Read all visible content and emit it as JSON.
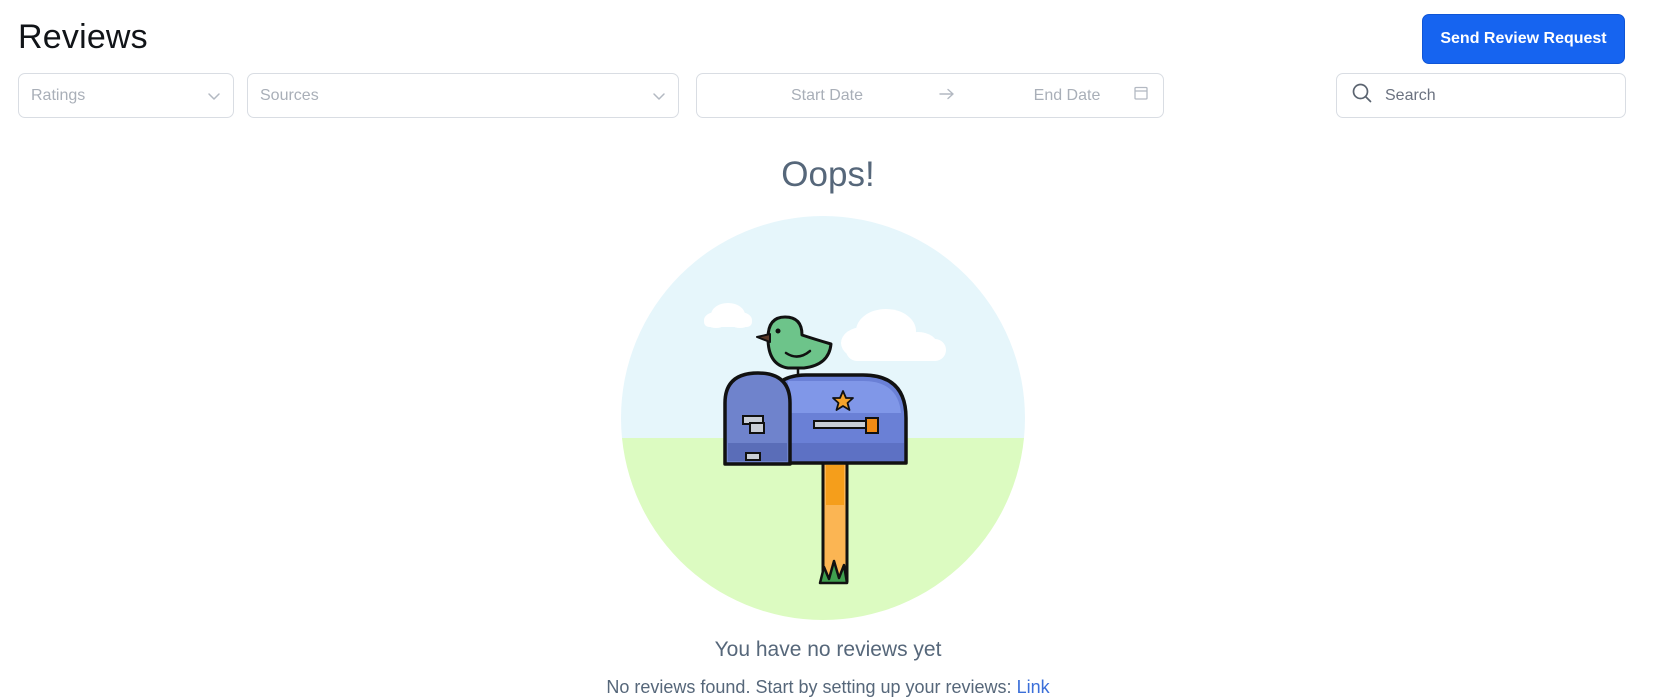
{
  "header": {
    "title": "Reviews",
    "send_button_label": "Send Review Request"
  },
  "filters": {
    "ratings_placeholder": "Ratings",
    "sources_placeholder": "Sources",
    "start_date_placeholder": "Start Date",
    "end_date_placeholder": "End Date",
    "search_placeholder": "Search"
  },
  "empty_state": {
    "title": "Oops!",
    "heading": "You have no reviews yet",
    "description": "No reviews found. Start by setting up your reviews:",
    "link_label": "Link"
  },
  "colors": {
    "primary": "#1664f0",
    "muted_text": "#56677a",
    "link": "#3b6fd9",
    "sky": "#e6f6fb",
    "grass": "#dcfbc1",
    "mailbox": "#6a80d6",
    "bird": "#6dc48a",
    "post": "#f5a32b"
  },
  "icons": {
    "ratings_dropdown": "chevron-down-icon",
    "sources_dropdown": "chevron-down-icon",
    "date_separator": "arrow-right-icon",
    "date_picker": "calendar-icon",
    "search": "search-icon"
  }
}
